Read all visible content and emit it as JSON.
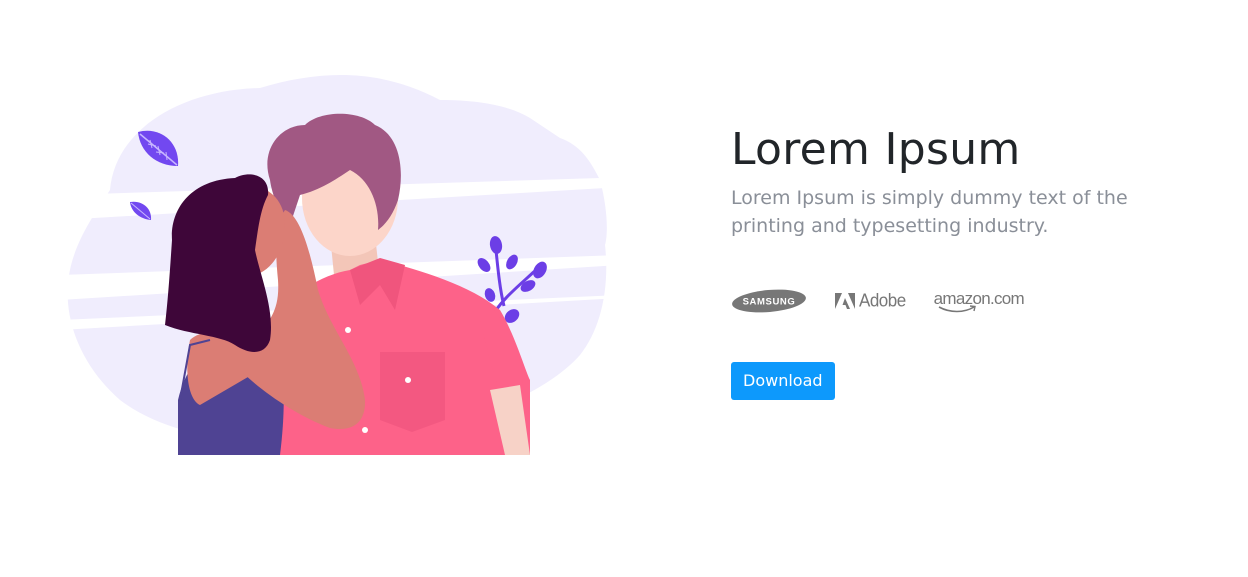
{
  "hero": {
    "title": "Lorem Ipsum",
    "subtitle": "Lorem Ipsum is simply dummy text of the printing and typesetting industry.",
    "cta_label": "Download"
  },
  "brands": [
    {
      "name": "SAMSUNG",
      "icon": "samsung-logo"
    },
    {
      "name": "Adobe",
      "icon": "adobe-logo"
    },
    {
      "name": "amazon.com",
      "icon": "amazon-logo"
    }
  ],
  "colors": {
    "accent": "#0d99fc",
    "heading": "#212529",
    "muted_text": "#8a8f98",
    "logo_gray": "#777777",
    "illustration_bg": "#f0edfd",
    "shirt": "#fd6289",
    "hair_man": "#a15883",
    "hair_woman": "#3e0639",
    "leaf": "#6c3ee6"
  }
}
